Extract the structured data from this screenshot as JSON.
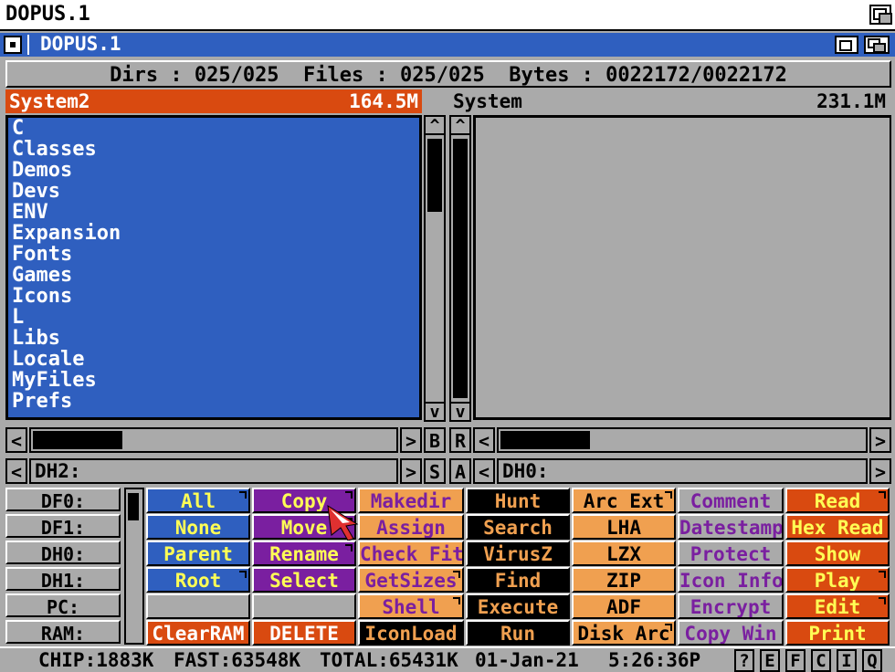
{
  "screen": {
    "title": "DOPUS.1"
  },
  "window": {
    "title": "DOPUS.1"
  },
  "stats": "Dirs : 025/025  Files : 025/025  Bytes : 0022172/0022172",
  "left_panel": {
    "name": "System2",
    "size": "164.5M",
    "path": "DH2:",
    "entries": [
      "C",
      "Classes",
      "Demos",
      "Devs",
      "ENV",
      "Expansion",
      "Fonts",
      "Games",
      "Icons",
      "L",
      "Libs",
      "Locale",
      "MyFiles",
      "Prefs"
    ]
  },
  "right_panel": {
    "name": "System",
    "size": "231.1M",
    "path": "DH0:"
  },
  "center": {
    "b": "B",
    "r": "R",
    "s": "S",
    "a": "A"
  },
  "scroll": {
    "up": "^",
    "down": "v",
    "left": "<",
    "right": ">"
  },
  "devices": [
    "DF0:",
    "DF1:",
    "DH0:",
    "DH1:",
    "PC:",
    "RAM:"
  ],
  "buttons": [
    [
      {
        "label": "All",
        "bg": "#2f5fbf",
        "fg": "#ffff55",
        "m": true
      },
      {
        "label": "None",
        "bg": "#2f5fbf",
        "fg": "#ffff55",
        "m": false
      },
      {
        "label": "Parent",
        "bg": "#2f5fbf",
        "fg": "#ffff55",
        "m": false
      },
      {
        "label": "Root",
        "bg": "#2f5fbf",
        "fg": "#ffff55",
        "m": true
      },
      {
        "label": "",
        "bg": "#aaaaaa",
        "fg": "#000000",
        "m": false
      },
      {
        "label": "ClearRAM",
        "bg": "#d94a10",
        "fg": "#ffffff",
        "m": false
      }
    ],
    [
      {
        "label": "Copy",
        "bg": "#7a1fa0",
        "fg": "#ffff55",
        "m": true
      },
      {
        "label": "Move",
        "bg": "#7a1fa0",
        "fg": "#ffff55",
        "m": true
      },
      {
        "label": "Rename",
        "bg": "#7a1fa0",
        "fg": "#ffff55",
        "m": true
      },
      {
        "label": "Select",
        "bg": "#7a1fa0",
        "fg": "#ffff55",
        "m": false
      },
      {
        "label": "",
        "bg": "#aaaaaa",
        "fg": "#000000",
        "m": false
      },
      {
        "label": "DELETE",
        "bg": "#d94a10",
        "fg": "#ffffff",
        "m": false
      }
    ],
    [
      {
        "label": "Makedir",
        "bg": "#f0a050",
        "fg": "#7a1fa0",
        "m": false
      },
      {
        "label": "Assign",
        "bg": "#f0a050",
        "fg": "#7a1fa0",
        "m": false
      },
      {
        "label": "Check Fit",
        "bg": "#f0a050",
        "fg": "#7a1fa0",
        "m": false
      },
      {
        "label": "GetSizes",
        "bg": "#f0a050",
        "fg": "#7a1fa0",
        "m": true
      },
      {
        "label": "Shell",
        "bg": "#f0a050",
        "fg": "#7a1fa0",
        "m": true
      },
      {
        "label": "IconLoad",
        "bg": "#000000",
        "fg": "#f0a050",
        "m": false
      }
    ],
    [
      {
        "label": "Hunt",
        "bg": "#000000",
        "fg": "#f0a050",
        "m": false
      },
      {
        "label": "Search",
        "bg": "#000000",
        "fg": "#f0a050",
        "m": false
      },
      {
        "label": "VirusZ",
        "bg": "#000000",
        "fg": "#f0a050",
        "m": false
      },
      {
        "label": "Find",
        "bg": "#000000",
        "fg": "#f0a050",
        "m": false
      },
      {
        "label": "Execute",
        "bg": "#000000",
        "fg": "#f0a050",
        "m": false
      },
      {
        "label": "Run",
        "bg": "#000000",
        "fg": "#f0a050",
        "m": false
      }
    ],
    [
      {
        "label": "Arc Ext",
        "bg": "#f0a050",
        "fg": "#000000",
        "m": true
      },
      {
        "label": "LHA",
        "bg": "#f0a050",
        "fg": "#000000",
        "m": false
      },
      {
        "label": "LZX",
        "bg": "#f0a050",
        "fg": "#000000",
        "m": false
      },
      {
        "label": "ZIP",
        "bg": "#f0a050",
        "fg": "#000000",
        "m": false
      },
      {
        "label": "ADF",
        "bg": "#f0a050",
        "fg": "#000000",
        "m": false
      },
      {
        "label": "Disk Arc",
        "bg": "#f0a050",
        "fg": "#000000",
        "m": true
      }
    ],
    [
      {
        "label": "Comment",
        "bg": "#aaaaaa",
        "fg": "#7a1fa0",
        "m": false
      },
      {
        "label": "Datestamp",
        "bg": "#aaaaaa",
        "fg": "#7a1fa0",
        "m": false
      },
      {
        "label": "Protect",
        "bg": "#aaaaaa",
        "fg": "#7a1fa0",
        "m": false
      },
      {
        "label": "Icon Info",
        "bg": "#aaaaaa",
        "fg": "#7a1fa0",
        "m": false
      },
      {
        "label": "Encrypt",
        "bg": "#aaaaaa",
        "fg": "#7a1fa0",
        "m": false
      },
      {
        "label": "Copy Win",
        "bg": "#aaaaaa",
        "fg": "#7a1fa0",
        "m": false
      }
    ],
    [
      {
        "label": "Read",
        "bg": "#d94a10",
        "fg": "#ffff55",
        "m": true
      },
      {
        "label": "Hex Read",
        "bg": "#d94a10",
        "fg": "#ffff55",
        "m": false
      },
      {
        "label": "Show",
        "bg": "#d94a10",
        "fg": "#ffff55",
        "m": false
      },
      {
        "label": "Play",
        "bg": "#d94a10",
        "fg": "#ffff55",
        "m": true
      },
      {
        "label": "Edit",
        "bg": "#d94a10",
        "fg": "#ffff55",
        "m": true
      },
      {
        "label": "Print",
        "bg": "#d94a10",
        "fg": "#ffff55",
        "m": false
      }
    ]
  ],
  "status": {
    "chip": "CHIP:1883K",
    "fast": "FAST:63548K",
    "total": "TOTAL:65431K",
    "date": "01-Jan-21",
    "time": "5:26:36P",
    "quick": [
      "?",
      "E",
      "F",
      "C",
      "I",
      "Q"
    ]
  }
}
